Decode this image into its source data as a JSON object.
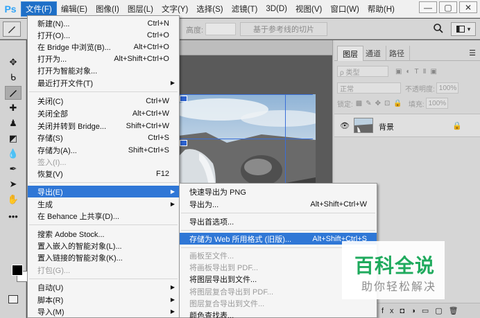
{
  "app": {
    "logo": "Ps"
  },
  "menubar": {
    "items": [
      "文件(F)",
      "编辑(E)",
      "图像(I)",
      "图层(L)",
      "文字(Y)",
      "选择(S)",
      "滤镜(T)",
      "3D(D)",
      "视图(V)",
      "窗口(W)",
      "帮助(H)"
    ],
    "active_index": 0,
    "window_buttons": [
      "—",
      "▢",
      "✕"
    ]
  },
  "options_bar": {
    "height_label": "高度:",
    "slice_button": "基于参考线的切片",
    "workspace_icon": "workspace-icon"
  },
  "layers_panel": {
    "tabs": [
      "图层",
      "通道",
      "路径"
    ],
    "filter_label": "ρ 类型",
    "blend_mode": "正常",
    "opacity_label": "不透明度:",
    "opacity_value": "100%",
    "lock_label": "锁定:",
    "fill_label": "填充:",
    "fill_value": "100%",
    "layer_name": "背景"
  },
  "file_menu": {
    "items": [
      {
        "label": "新建(N)...",
        "shortcut": "Ctrl+N"
      },
      {
        "label": "打开(O)...",
        "shortcut": "Ctrl+O"
      },
      {
        "label": "在 Bridge 中浏览(B)...",
        "shortcut": "Alt+Ctrl+O"
      },
      {
        "label": "打开为...",
        "shortcut": "Alt+Shift+Ctrl+O"
      },
      {
        "label": "打开为智能对象...",
        "shortcut": ""
      },
      {
        "label": "最近打开文件(T)",
        "shortcut": "",
        "submenu": true
      },
      {
        "label": "关闭(C)",
        "shortcut": "Ctrl+W"
      },
      {
        "label": "关闭全部",
        "shortcut": "Alt+Ctrl+W"
      },
      {
        "label": "关闭并转到 Bridge...",
        "shortcut": "Shift+Ctrl+W"
      },
      {
        "label": "存储(S)",
        "shortcut": "Ctrl+S"
      },
      {
        "label": "存储为(A)...",
        "shortcut": "Shift+Ctrl+S"
      },
      {
        "label": "签入(I)...",
        "shortcut": "",
        "disabled": true
      },
      {
        "label": "恢复(V)",
        "shortcut": "F12"
      },
      {
        "label": "导出(E)",
        "shortcut": "",
        "submenu": true,
        "highlighted": true
      },
      {
        "label": "生成",
        "shortcut": "",
        "submenu": true
      },
      {
        "label": "在 Behance 上共享(D)...",
        "shortcut": ""
      },
      {
        "label": "搜索 Adobe Stock...",
        "shortcut": ""
      },
      {
        "label": "置入嵌入的智能对象(L)...",
        "shortcut": ""
      },
      {
        "label": "置入链接的智能对象(K)...",
        "shortcut": ""
      },
      {
        "label": "打包(G)...",
        "shortcut": "",
        "disabled": true
      },
      {
        "label": "自动(U)",
        "shortcut": "",
        "submenu": true
      },
      {
        "label": "脚本(R)",
        "shortcut": "",
        "submenu": true
      },
      {
        "label": "导入(M)",
        "shortcut": "",
        "submenu": true
      }
    ]
  },
  "export_menu": {
    "items": [
      {
        "label": "快速导出为 PNG",
        "shortcut": ""
      },
      {
        "label": "导出为...",
        "shortcut": "Alt+Shift+Ctrl+W"
      },
      {
        "label": "导出首选项...",
        "shortcut": ""
      },
      {
        "label": "存储为 Web 所用格式 (旧版)...",
        "shortcut": "Alt+Shift+Ctrl+S",
        "highlighted": true
      },
      {
        "label": "画板至文件...",
        "shortcut": "",
        "disabled": true
      },
      {
        "label": "将画板导出到 PDF...",
        "shortcut": "",
        "disabled": true
      },
      {
        "label": "将图层导出到文件...",
        "shortcut": ""
      },
      {
        "label": "将图层复合导出到 PDF...",
        "shortcut": "",
        "disabled": true
      },
      {
        "label": "图层复合导出到文件...",
        "shortcut": "",
        "disabled": true
      },
      {
        "label": "颜色查找表...",
        "shortcut": ""
      }
    ]
  },
  "watermark": {
    "title": "百科全说",
    "subtitle": "助你轻松解决"
  },
  "colors": {
    "accent": "#2f77d6",
    "menu_bg": "#f5f5f5",
    "watermark_green": "#1faa5d"
  }
}
